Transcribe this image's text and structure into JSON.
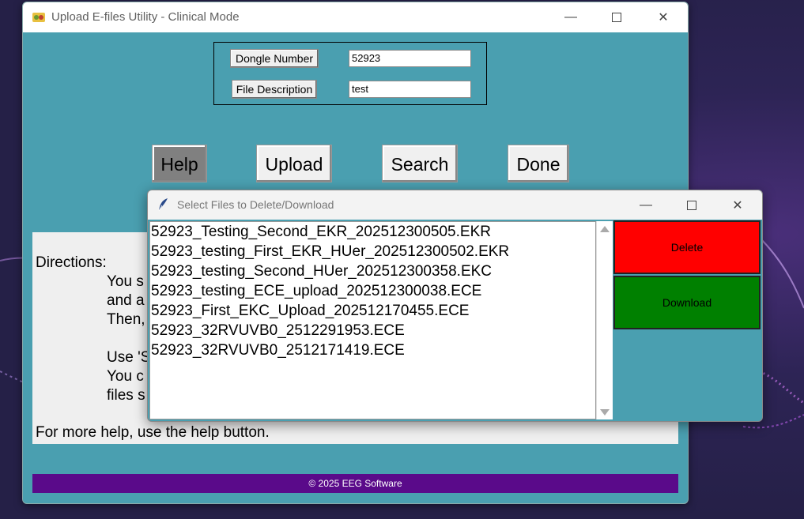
{
  "main_window": {
    "title": "Upload E-files Utility - Clinical Mode",
    "form": {
      "dongle_label": "Dongle Number",
      "dongle_value": "52923",
      "desc_label": "File Description",
      "desc_value": "test"
    },
    "buttons": {
      "help": "Help",
      "upload": "Upload",
      "search": "Search",
      "done": "Done"
    },
    "directions": {
      "heading": "Directions:",
      "lines": [
        "You s",
        "and a",
        "Then,",
        "Use 'S",
        "You c",
        "files s"
      ],
      "footer_line": "For more help, use the help button."
    },
    "footer": "© 2025 EEG Software"
  },
  "dialog": {
    "title": "Select Files to Delete/Download",
    "files": [
      "52923_Testing_Second_EKR_202512300505.EKR",
      "52923_testing_First_EKR_HUer_202512300502.EKR",
      "52923_testing_Second_HUer_202512300358.EKC",
      "52923_testing_ECE_upload_202512300038.ECE",
      "52923_First_EKC_Upload_202512170455.ECE",
      "52923_32RVUVB0_2512291953.ECE",
      "52923_32RVUVB0_2512171419.ECE"
    ],
    "delete_label": "Delete",
    "download_label": "Download"
  },
  "colors": {
    "window_bg": "#4a9fb0",
    "delete_btn": "#ff0000",
    "download_btn": "#008000",
    "footer_bg": "#5a0a8a",
    "help_btn": "#808080"
  }
}
